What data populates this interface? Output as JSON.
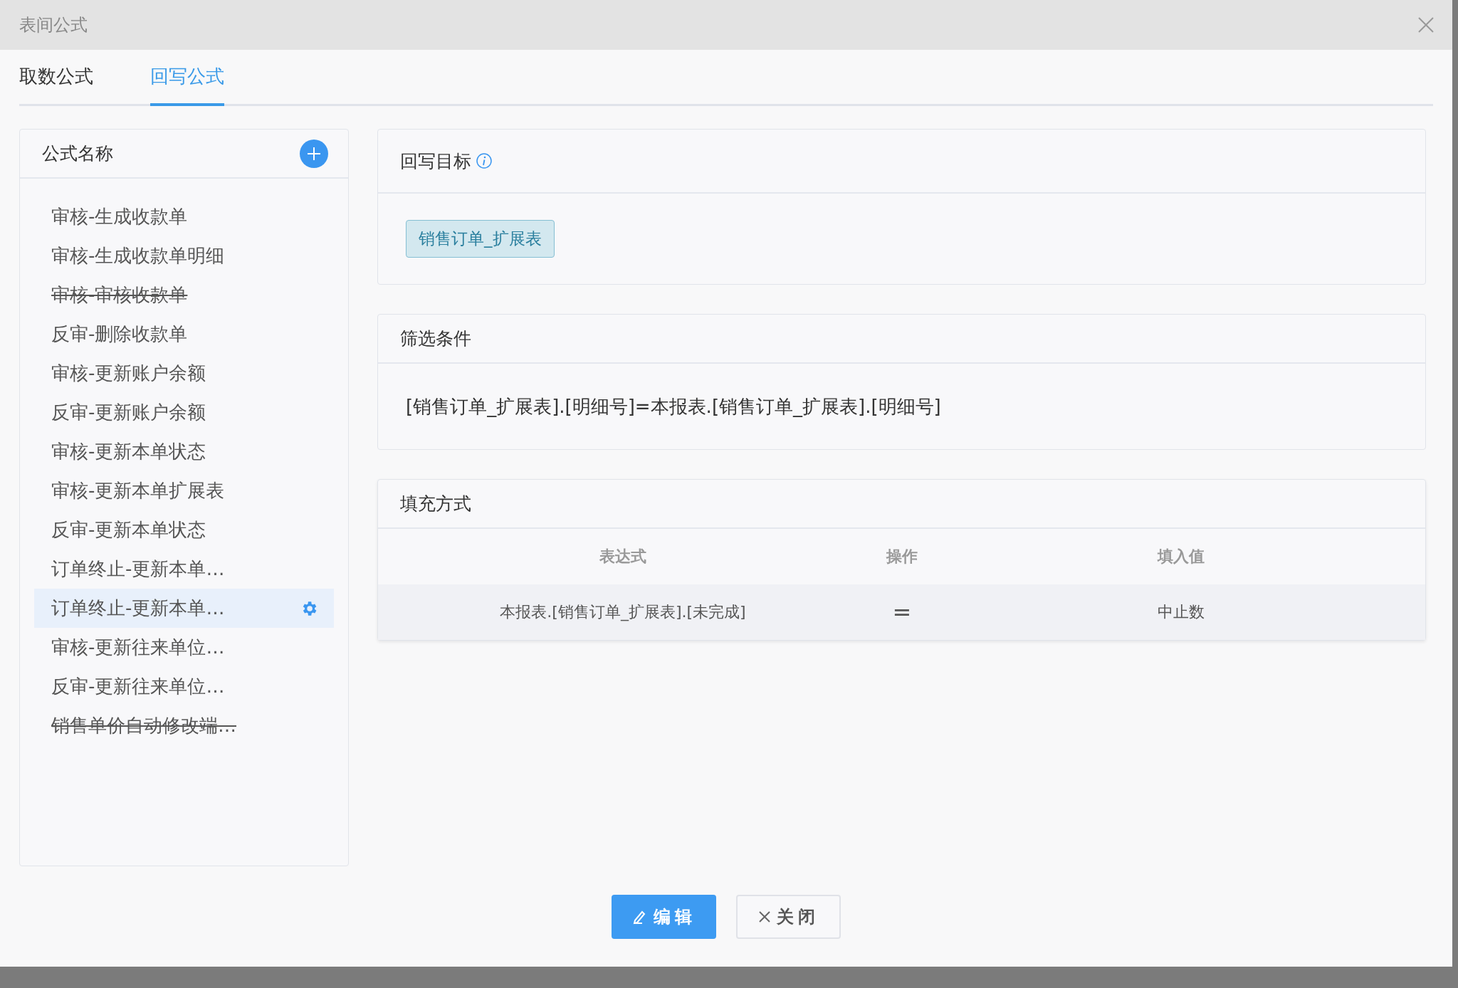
{
  "window": {
    "title": "表间公式"
  },
  "tabs": [
    {
      "label": "取数公式",
      "selected": false
    },
    {
      "label": "回写公式",
      "selected": true
    }
  ],
  "formula_list": {
    "title": "公式名称",
    "items": [
      {
        "label": "审核-生成收款单",
        "struck": false,
        "selected": false
      },
      {
        "label": "审核-生成收款单明细",
        "struck": false,
        "selected": false
      },
      {
        "label": "审核-审核收款单",
        "struck": true,
        "selected": false
      },
      {
        "label": "反审-删除收款单",
        "struck": false,
        "selected": false
      },
      {
        "label": "审核-更新账户余额",
        "struck": false,
        "selected": false
      },
      {
        "label": "反审-更新账户余额",
        "struck": false,
        "selected": false
      },
      {
        "label": "审核-更新本单状态",
        "struck": false,
        "selected": false
      },
      {
        "label": "审核-更新本单扩展表",
        "struck": false,
        "selected": false
      },
      {
        "label": "反审-更新本单状态",
        "struck": false,
        "selected": false
      },
      {
        "label": "订单终止-更新本单…",
        "struck": false,
        "selected": false
      },
      {
        "label": "订单终止-更新本单…",
        "struck": false,
        "selected": true
      },
      {
        "label": "审核-更新往来单位…",
        "struck": false,
        "selected": false
      },
      {
        "label": "反审-更新往来单位…",
        "struck": false,
        "selected": false
      },
      {
        "label": "销售单价自动修改端…",
        "struck": true,
        "selected": false
      }
    ]
  },
  "target": {
    "title": "回写目标",
    "tag": "销售订单_扩展表"
  },
  "filter": {
    "title": "筛选条件",
    "expression": "[销售订单_扩展表].[明细号]=本报表.[销售订单_扩展表].[明细号]"
  },
  "fill": {
    "title": "填充方式",
    "columns": [
      "表达式",
      "操作",
      "填入值"
    ],
    "rows": [
      [
        "本报表.[销售订单_扩展表].[未完成]",
        "=",
        "中止数"
      ]
    ]
  },
  "buttons": [
    {
      "label": "编辑",
      "kind": "primary"
    },
    {
      "label": "关闭",
      "kind": "default"
    }
  ]
}
